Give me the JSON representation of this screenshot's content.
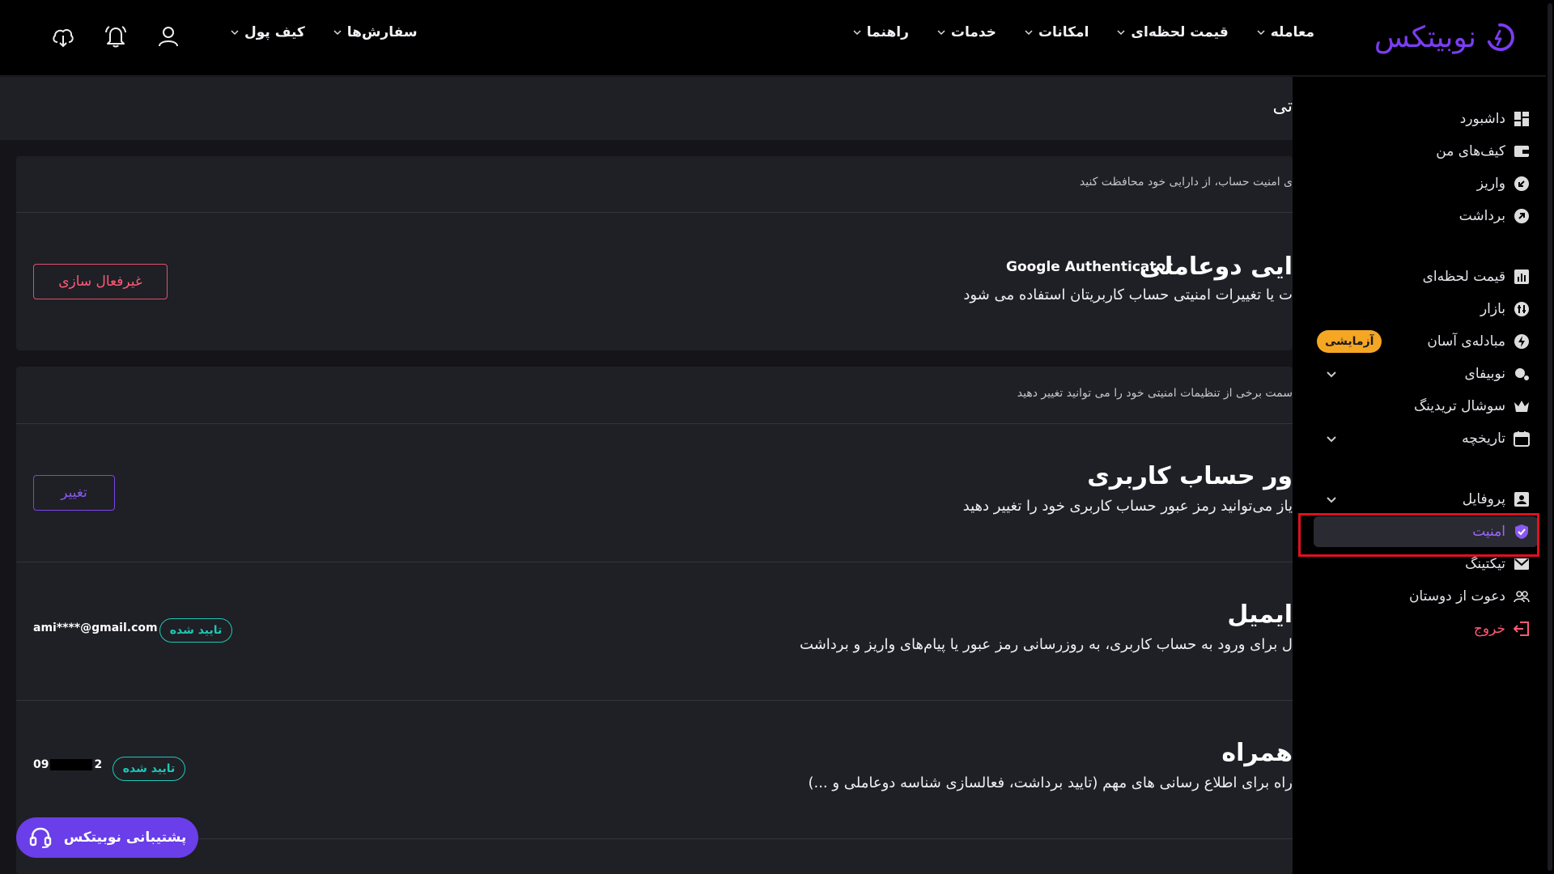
{
  "header": {
    "logo_text": "نوبیتکس",
    "nav": [
      {
        "label": "معامله"
      },
      {
        "label": "قیمت لحظه‌ای"
      },
      {
        "label": "امکانات"
      },
      {
        "label": "خدمات"
      },
      {
        "label": "راهنما"
      }
    ],
    "orders_label": "سفارش‌ها",
    "wallet_label": "کیف پول",
    "icons": [
      "user-icon",
      "bell-icon",
      "download-app-icon"
    ]
  },
  "page": {
    "title": "تی"
  },
  "card1": {
    "subtitle": "ی امنیت حساب، از دارایی خود محافظت کنید",
    "twofa_title": "ایی دوعاملی",
    "twofa_app": "Google Authenticator",
    "twofa_desc": "ت یا تغییرات امنیتی حساب کاربریتان استفاده می شود",
    "disable_button": "غیرفعال سازی"
  },
  "card2": {
    "subtitle": "سمت برخی از تنظیمات امنیتی خود را می توانید تغییر دهید",
    "password_title": "ور حساب کاربری",
    "password_desc": "یاز می‌توانید رمز عبور حساب کاربری خود را تغییر دهید",
    "change_button": "تغییر",
    "email_title": "ایمیل",
    "email_desc": "ل برای ورود به حساب کاربری، به روزرسانی رمز عبور یا پیام‌های واریز و برداشت",
    "email_value": "ami****@gmail.com",
    "email_status": "تایید شده",
    "phone_title": "همراه",
    "phone_desc": "راه برای اطلاع رسانی های مهم (تایید برداشت، فعالسازی شناسه دوعاملی و ...)",
    "phone_prefix": "09",
    "phone_suffix": "2",
    "phone_status": "تایید شده"
  },
  "sidebar": {
    "items": [
      {
        "label": "داشبورد",
        "icon": "dashboard-icon"
      },
      {
        "label": "کیف‌های من",
        "icon": "wallet-icon"
      },
      {
        "label": "واریز",
        "icon": "deposit-icon"
      },
      {
        "label": "برداشت",
        "icon": "withdraw-icon"
      },
      {
        "label": "قیمت لحظه‌ای",
        "icon": "chart-icon"
      },
      {
        "label": "بازار",
        "icon": "market-icon"
      },
      {
        "label": "مبادله‌ی آسان",
        "icon": "lightning-icon",
        "badge": "آزمایشی"
      },
      {
        "label": "نوبیفای",
        "icon": "nobifi-icon"
      },
      {
        "label": "سوشال تریدینگ",
        "icon": "crown-icon"
      },
      {
        "label": "تاریخچه",
        "icon": "calendar-icon"
      },
      {
        "label": "پروفایل",
        "icon": "profile-icon"
      },
      {
        "label": "امنیت",
        "icon": "shield-icon"
      },
      {
        "label": "تیکتینگ",
        "icon": "mail-icon"
      },
      {
        "label": "دعوت از دوستان",
        "icon": "users-icon"
      },
      {
        "label": "خروج",
        "icon": "logout-icon"
      }
    ]
  },
  "support": {
    "label": "پشتیبانی نوبیتکس"
  },
  "colors": {
    "accent": "#7c3cf2",
    "danger": "#ff5a78",
    "success": "#1fc7b3",
    "badge": "#f5a623"
  }
}
